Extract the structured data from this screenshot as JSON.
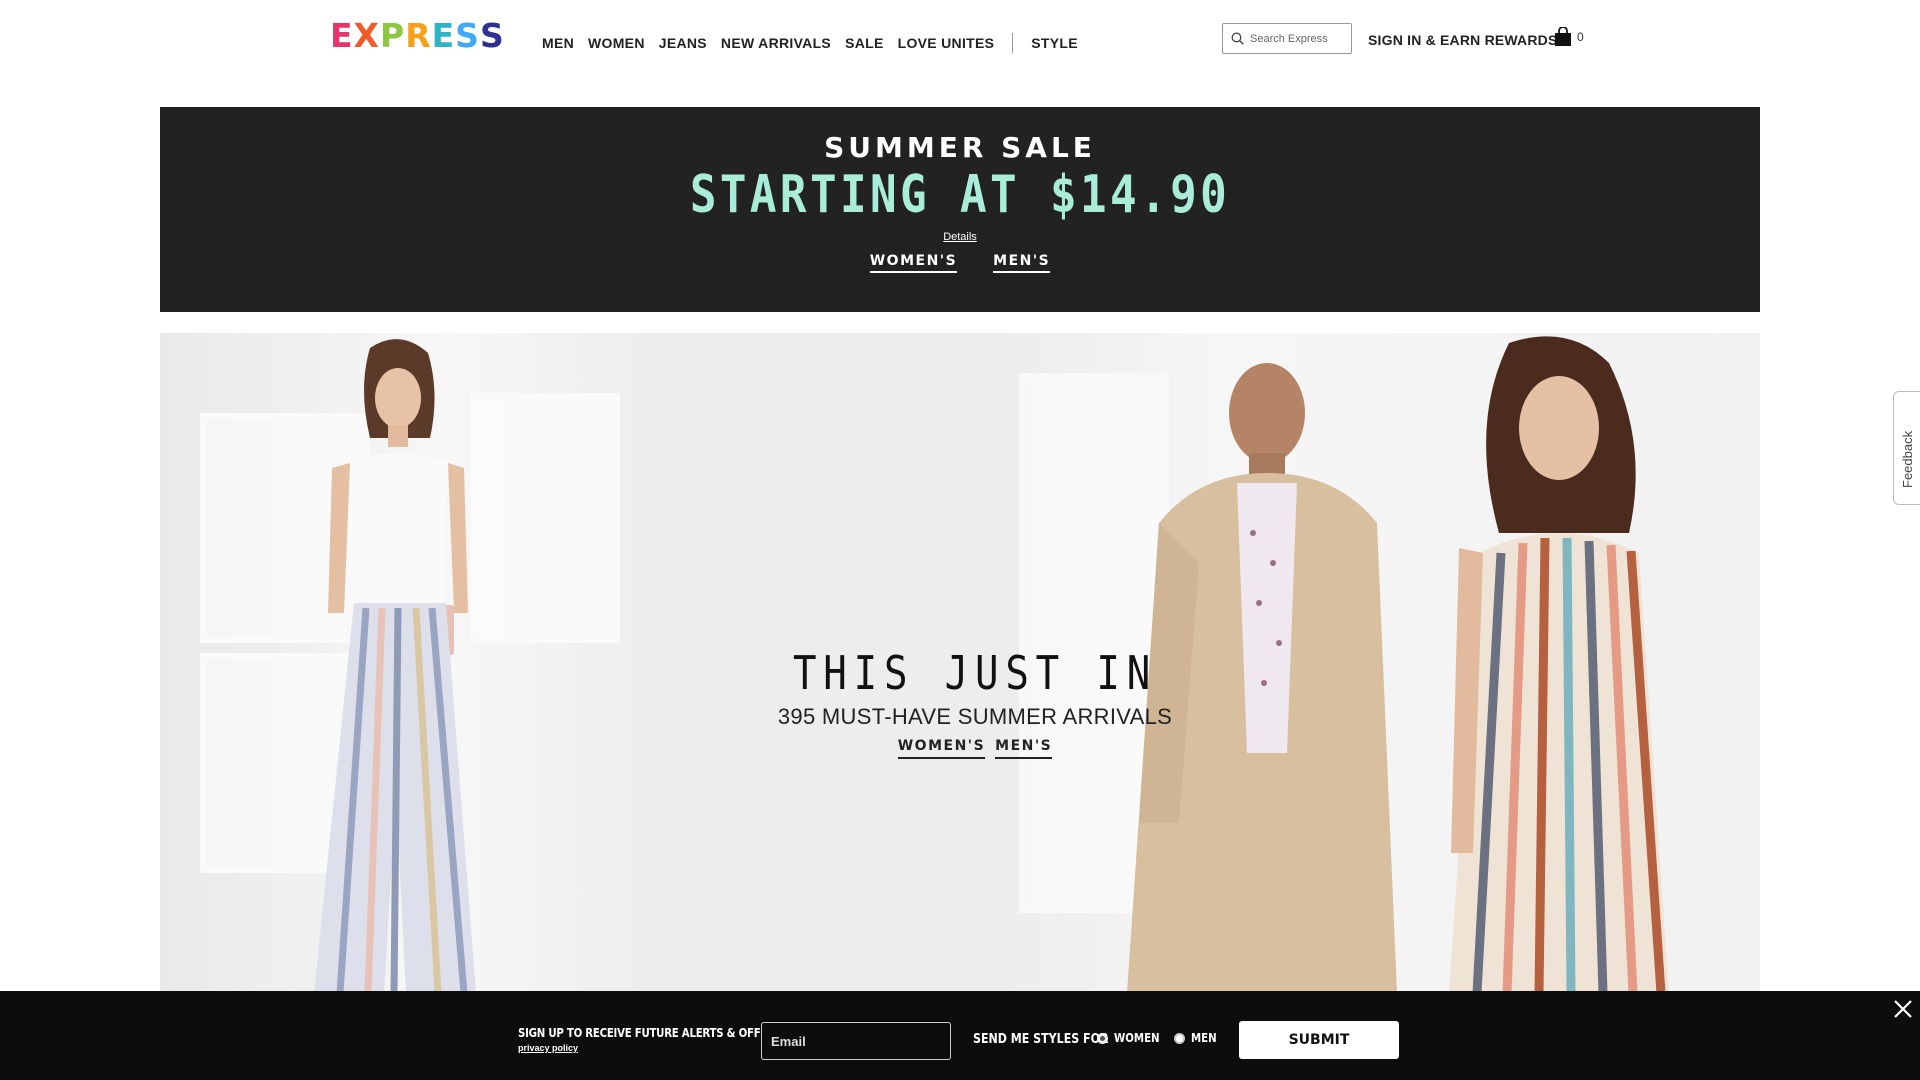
{
  "header": {
    "logo_letters": [
      {
        "char": "E",
        "color": "#e8336b"
      },
      {
        "char": "X",
        "color": "#f15a29"
      },
      {
        "char": "P",
        "color": "#8dc63f"
      },
      {
        "char": "R",
        "color": "#f7a11a"
      },
      {
        "char": "E",
        "color": "#2bb5c5"
      },
      {
        "char": "S",
        "color": "#3fa9f5"
      },
      {
        "char": "S",
        "color": "#2e3192"
      }
    ],
    "nav": [
      "MEN",
      "WOMEN",
      "JEANS",
      "NEW ARRIVALS",
      "SALE",
      "LOVE UNITES"
    ],
    "nav_extra": "STYLE",
    "search_placeholder": "Search Express",
    "signin": "SIGN IN & EARN REWARDS",
    "bag_count": "0"
  },
  "sale_banner": {
    "title": "SUMMER SALE",
    "subtitle": "STARTING AT $14.90",
    "details": "Details",
    "links": [
      "WOMEN'S",
      "MEN'S"
    ],
    "accent_color": "#a9ecd7"
  },
  "hero": {
    "title": "THIS JUST IN",
    "subtitle": "395 MUST-HAVE SUMMER ARRIVALS",
    "links": [
      "WOMEN'S",
      "MEN'S"
    ]
  },
  "feedback": {
    "label": "Feedback"
  },
  "signup": {
    "heading": "SIGN UP TO RECEIVE FUTURE ALERTS & OFFERS",
    "privacy": "privacy policy",
    "email_placeholder": "Email",
    "styles_label": "SEND ME STYLES FOR",
    "options": [
      "WOMEN",
      "MEN"
    ],
    "selected": "WOMEN",
    "submit": "SUBMIT"
  }
}
